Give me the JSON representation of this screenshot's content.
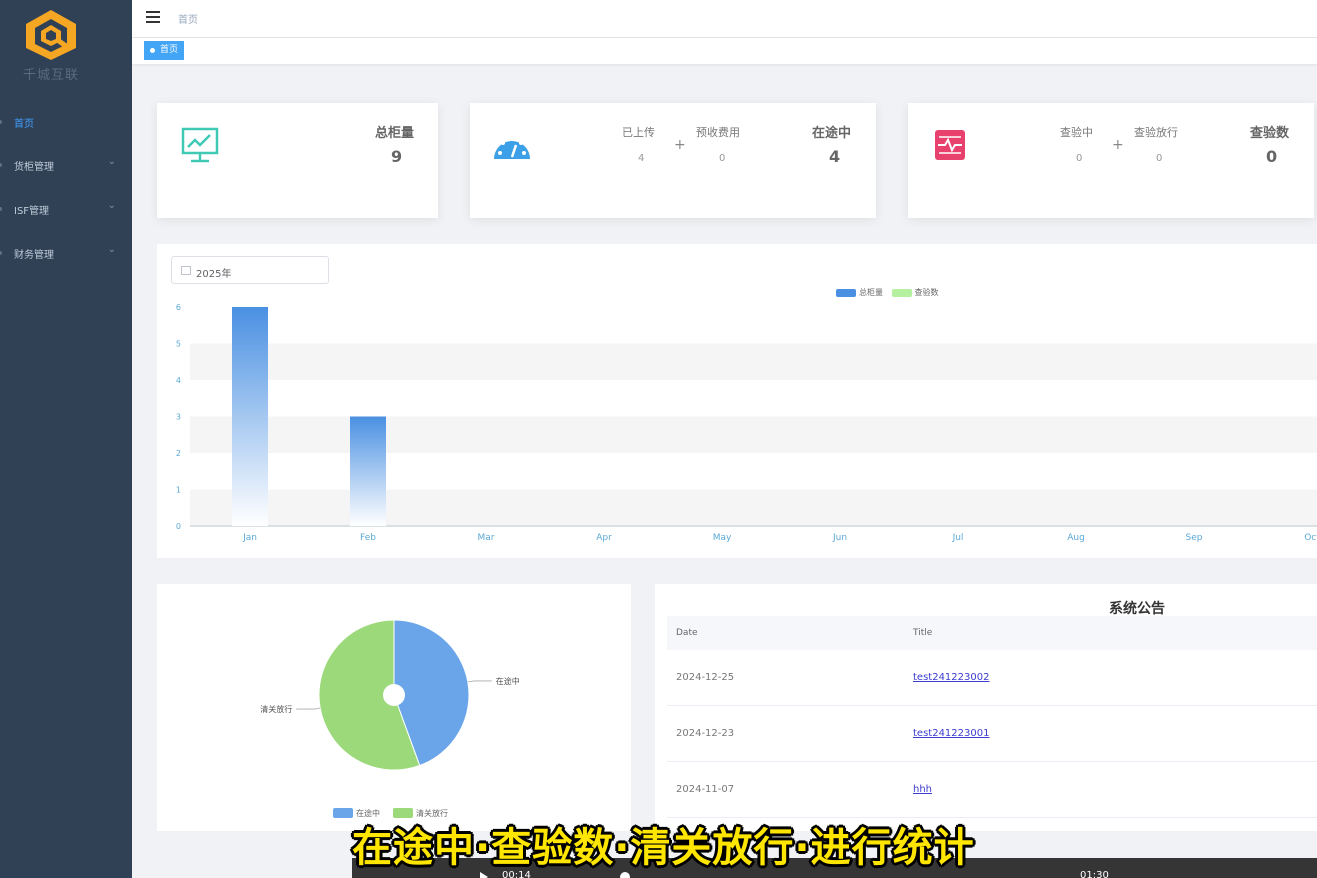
{
  "brand": {
    "name": "千城互联"
  },
  "sidebar": {
    "items": [
      {
        "label": "首页",
        "active": true
      },
      {
        "label": "货柜管理",
        "has_children": true
      },
      {
        "label": "ISF管理",
        "has_children": true
      },
      {
        "label": "财务管理",
        "has_children": true
      }
    ]
  },
  "header": {
    "breadcrumb": "首页"
  },
  "tags": [
    {
      "label": "首页"
    }
  ],
  "cards": {
    "total": {
      "title": "总柜量",
      "value": "9"
    },
    "transit": {
      "uploaded_label": "已上传",
      "uploaded_value": "4",
      "prepaid_label": "预收费用",
      "prepaid_value": "0",
      "title": "在途中",
      "value": "4"
    },
    "inspect": {
      "checking_label": "查验中",
      "checking_value": "0",
      "released_label": "查验放行",
      "released_value": "0",
      "title": "查验数",
      "value": "0"
    }
  },
  "year_picker": {
    "value": "2025年"
  },
  "chart_data": [
    {
      "type": "bar",
      "categories": [
        "Jan",
        "Feb",
        "Mar",
        "Apr",
        "May",
        "Jun",
        "Jul",
        "Aug",
        "Sep",
        "Oct"
      ],
      "series": [
        {
          "name": "总柜量",
          "values": [
            6,
            3,
            0,
            0,
            0,
            0,
            0,
            0,
            0,
            0
          ],
          "color": "#4a90e2"
        },
        {
          "name": "查验数",
          "values": [
            0,
            0,
            0,
            0,
            0,
            0,
            0,
            0,
            0,
            0
          ],
          "color": "#b4f0a0"
        }
      ],
      "yticks": [
        0,
        1,
        2,
        3,
        4,
        5,
        6
      ],
      "ylim": [
        0,
        6
      ],
      "legend": "top-center"
    },
    {
      "type": "pie",
      "series": [
        {
          "name": "在途中",
          "value": 4,
          "color": "#6aa5ea"
        },
        {
          "name": "清关放行",
          "value": 5,
          "color": "#9cd97a"
        }
      ],
      "legend": "bottom-center"
    }
  ],
  "notice": {
    "title": "系统公告",
    "columns": [
      "Date",
      "Title"
    ],
    "rows": [
      {
        "date": "2024-12-25",
        "title": "test241223002"
      },
      {
        "date": "2024-12-23",
        "title": "test241223001"
      },
      {
        "date": "2024-11-07",
        "title": "hhh"
      }
    ]
  },
  "video": {
    "subtitle": "在途中·查验数·清关放行·进行统计",
    "current_time": "00:14",
    "total_time": "01:30"
  }
}
